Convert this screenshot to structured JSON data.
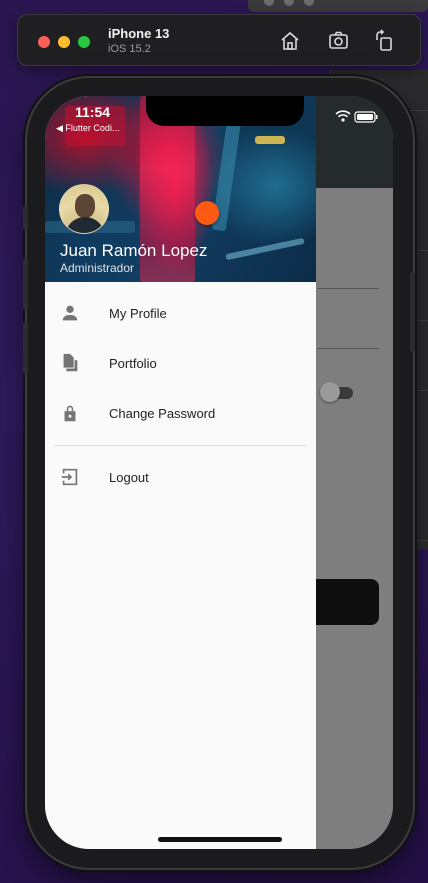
{
  "simulator": {
    "device_name": "iPhone 13",
    "os_version": "iOS 15.2",
    "buttons": [
      "home-icon",
      "screenshot-icon",
      "rotate-icon"
    ]
  },
  "status_bar": {
    "time": "11:54",
    "back_app": "◀ Flutter Codi..."
  },
  "drawer": {
    "header": {
      "user_name": "Juan Ramón Lopez",
      "user_role": "Administrador",
      "accent_dot_color": "#ff5a14"
    },
    "items": [
      {
        "label": "My Profile",
        "icon": "person-icon"
      },
      {
        "label": "Portfolio",
        "icon": "files-icon"
      },
      {
        "label": "Change Password",
        "icon": "lock-icon"
      },
      {
        "label": "Logout",
        "icon": "logout-icon"
      }
    ]
  },
  "colors": {
    "drawer_bg": "#fafafa",
    "icon_grey": "#757575",
    "app_bar": "#252a2c"
  }
}
